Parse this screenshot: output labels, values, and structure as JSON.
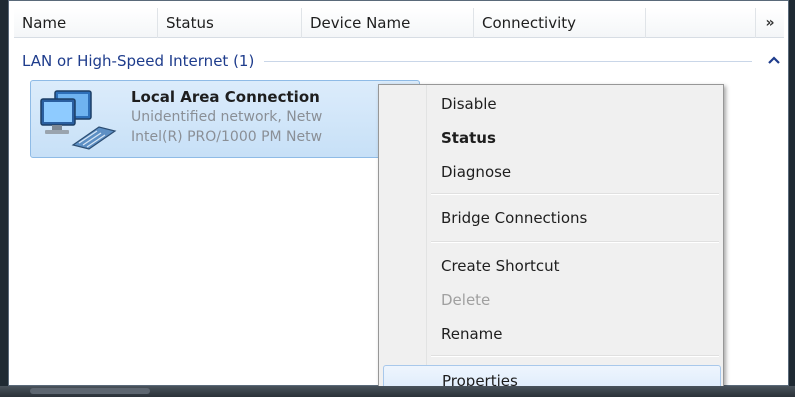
{
  "columns": {
    "name": "Name",
    "status": "Status",
    "device_name": "Device Name",
    "connectivity": "Connectivity",
    "more": "»"
  },
  "group": {
    "label": "LAN or High-Speed Internet (1)",
    "collapse_icon": "chevron-up-icon"
  },
  "connection": {
    "name": "Local Area Connection",
    "network": "Unidentified network, Netw",
    "adapter": "Intel(R) PRO/1000 PM Netw",
    "icon": "network-adapter-icon"
  },
  "context_menu": {
    "disable": "Disable",
    "status": "Status",
    "diagnose": "Diagnose",
    "bridge": "Bridge Connections",
    "create_shortcut": "Create Shortcut",
    "delete": "Delete",
    "rename": "Rename",
    "properties": "Properties"
  },
  "colors": {
    "group_text": "#1e3c8c",
    "selection": "#c7e0f7",
    "menu_hover": "#dcebfc"
  }
}
